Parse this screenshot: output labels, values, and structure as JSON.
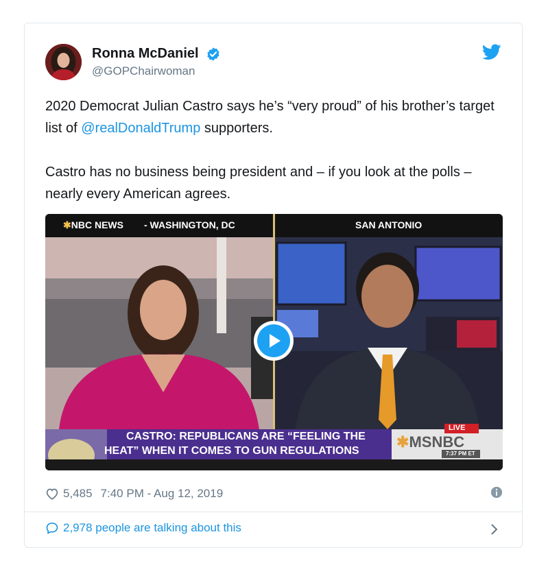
{
  "tweet": {
    "author": {
      "display_name": "Ronna McDaniel",
      "handle": "@GOPChairwoman",
      "verified": true
    },
    "paragraph1": {
      "before": "2020 Democrat Julian Castro says he’s “very proud” of his brother’s target list of ",
      "mention": "@realDonaldTrump",
      "after": " supporters."
    },
    "paragraph2": "Castro has no business being president and – if you look at the polls – nearly every American agrees.",
    "media": {
      "network_label": "NBC NEWS",
      "location_left": "- WASHINGTON, DC",
      "location_right": "SAN ANTONIO",
      "chyron_line1": "CASTRO: REPUBLICANS ARE “FEELING THE",
      "chyron_line2": "HEAT” WHEN IT COMES TO GUN REGULATIONS",
      "live_badge": "LIVE",
      "channel": "MSNBC",
      "clock": "7:37 PM ET"
    },
    "likes": "5,485",
    "timestamp": "7:40 PM - Aug 12, 2019",
    "talking": "2,978 people are talking about this"
  },
  "colors": {
    "accent": "#1da1f2",
    "link": "#1b95e0",
    "muted": "#657786",
    "chyron_purple": "#4b2f8f",
    "live_red": "#d32027"
  },
  "icons": [
    "verified-badge-icon",
    "twitter-bird-icon",
    "play-icon",
    "heart-icon",
    "info-icon",
    "speech-bubble-icon",
    "chevron-right-icon"
  ]
}
